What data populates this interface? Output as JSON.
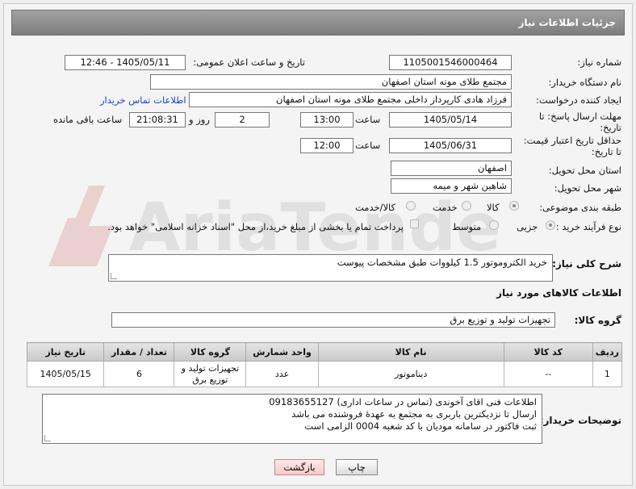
{
  "header": {
    "title": "جزئیات اطلاعات نیاز"
  },
  "fields": {
    "need_number_label": "شماره نیاز:",
    "need_number": "1105001546000464",
    "announce_label": "تاریخ و ساعت اعلان عمومی:",
    "announce_value": "1405/05/11 - 12:46",
    "buyer_org_label": "نام دستگاه خریدار:",
    "buyer_org": "مجتمع طلای موته استان اصفهان",
    "creator_label": "ایجاد کننده درخواست:",
    "creator": "فرزاد هادی کارپرداز داخلی مجتمع طلای موته استان اصفهان",
    "buyer_contact_link": "اطلاعات تماس خریدار",
    "deadline_label_1": "مهلت ارسال پاسخ: تا",
    "deadline_label_2": "تاریخ:",
    "deadline_date": "1405/05/14",
    "time_label": "ساعت",
    "deadline_time": "13:00",
    "remaining_days": "2",
    "day_and_label": "روز و",
    "remaining_time": "21:08:31",
    "remaining_label": "ساعت باقی مانده",
    "validity_label_1": "حداقل تاریخ اعتبار قیمت:",
    "validity_label_2": "تا تاریخ:",
    "validity_date": "1405/06/31",
    "validity_time": "12:00",
    "province_label": "استان محل تحویل:",
    "province": "اصفهان",
    "city_label": "شهر محل تحویل:",
    "city": "شاهین شهر و میمه",
    "category_label": "طبقه بندی موضوعی:",
    "category_options": [
      "کالا",
      "خدمت",
      "کالا/خدمت"
    ],
    "process_label": "نوع فرآیند خرید :",
    "process_options": [
      "جزیی",
      "متوسط"
    ],
    "payment_note": "پرداخت تمام یا بخشی از مبلغ خرید،از محل \"اسناد خزانه اسلامی\" خواهد بود."
  },
  "description": {
    "label": "شرح کلی نیاز:",
    "value": "خرید الکتروموتور 1.5 کیلووات طبق مشخصات پیوست"
  },
  "goods": {
    "section_title": "اطلاعات کالاهای مورد نیاز",
    "group_label": "گروه کالا:",
    "group_value": "تجهیزات تولید و توزیع برق",
    "columns": [
      "ردیف",
      "کد کالا",
      "نام کالا",
      "واحد شمارش",
      "گروه کالا",
      "تعداد / مقدار",
      "تاریخ نیاز"
    ],
    "rows": [
      [
        "1",
        "--",
        "دیناموتور",
        "عدد",
        "تجهیزات تولید و توزیع برق",
        "6",
        "1405/05/15"
      ]
    ]
  },
  "buyer_notes": {
    "label": "توضیحات خریدار:",
    "lines": [
      "اطلاعات فنی اقای آخوندی (تماس در ساعات اداری) 09183655127",
      "ارسال تا نزدیکترین باربری به  مجتمع به عهدهٔ فروشنده می باشد",
      "ثبت فاکتور در سامانه مودیان با کد شعبه 0004 الزامی است"
    ]
  },
  "buttons": {
    "print": "چاپ",
    "back": "بازگشت"
  },
  "watermark": {
    "text": "AriaTender.net"
  }
}
